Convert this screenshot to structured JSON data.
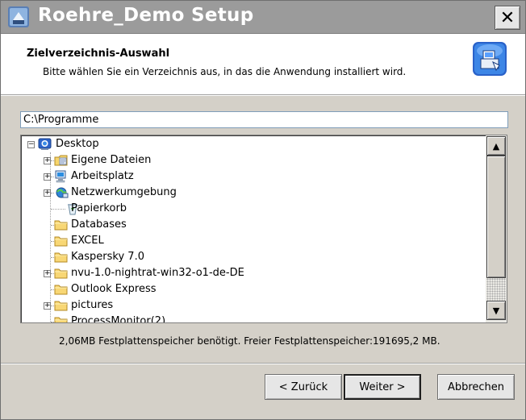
{
  "window": {
    "title": "Roehre_Demo Setup",
    "close_label": "✕"
  },
  "header": {
    "title": "Zielverzeichnis-Auswahl",
    "subtitle": "Bitte wählen Sie ein Verzeichnis aus, in das die Anwendung installiert wird."
  },
  "path": {
    "value": "C:\\Programme"
  },
  "tree": {
    "items": [
      {
        "label": "Desktop",
        "icon": "desktop-icon",
        "level": 0,
        "expander": "−"
      },
      {
        "label": "Eigene Dateien",
        "icon": "documents-folder-icon",
        "level": 1,
        "expander": "+"
      },
      {
        "label": "Arbeitsplatz",
        "icon": "computer-icon",
        "level": 1,
        "expander": "+"
      },
      {
        "label": "Netzwerkumgebung",
        "icon": "network-icon",
        "level": 1,
        "expander": "+"
      },
      {
        "label": "Papierkorb",
        "icon": "recycle-bin-icon",
        "level": 1,
        "expander": ""
      },
      {
        "label": "Databases",
        "icon": "folder-icon",
        "level": 1,
        "expander": ""
      },
      {
        "label": "EXCEL",
        "icon": "folder-icon",
        "level": 1,
        "expander": ""
      },
      {
        "label": "Kaspersky 7.0",
        "icon": "folder-icon",
        "level": 1,
        "expander": ""
      },
      {
        "label": "nvu-1.0-nightrat-win32-o1-de-DE",
        "icon": "folder-icon",
        "level": 1,
        "expander": "+"
      },
      {
        "label": "Outlook Express",
        "icon": "folder-icon",
        "level": 1,
        "expander": ""
      },
      {
        "label": "pictures",
        "icon": "folder-icon",
        "level": 1,
        "expander": "+"
      },
      {
        "label": "ProcessMonitor(2)",
        "icon": "folder-icon",
        "level": 1,
        "expander": ""
      }
    ]
  },
  "space_info": "2,06MB Festplattenspeicher benötigt. Freier Festplattenspeicher:191695,2 MB.",
  "buttons": {
    "back": "< Zurück",
    "next": "Weiter >",
    "cancel": "Abbrechen"
  },
  "scrollbar": {
    "up": "▲",
    "down": "▼"
  }
}
